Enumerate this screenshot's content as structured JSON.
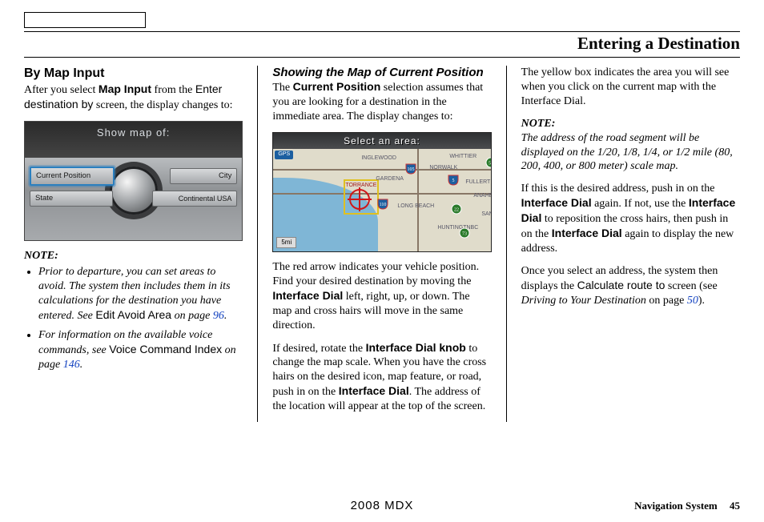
{
  "header": {
    "title": "Entering a Destination"
  },
  "footer": {
    "model": "2008 MDX",
    "system_label": "Navigation System",
    "page_number": "45"
  },
  "col1": {
    "heading": "By Map Input",
    "intro_1": "After you select ",
    "intro_bold": "Map Input",
    "intro_2": " from the ",
    "intro_sans": "Enter destination by",
    "intro_3": " screen, the display changes to:",
    "fig": {
      "title": "Show map of:",
      "btn_cp": "Current Position",
      "btn_city": "City",
      "btn_state": "State",
      "btn_cont": "Continental USA"
    },
    "note_label": "NOTE:",
    "bullet1_a": "Prior to departure, you can set areas to avoid. The system then includes them in its calculations for the destination you have entered. See ",
    "bullet1_sans": "Edit Avoid Area",
    "bullet1_b": " on page ",
    "bullet1_link": "96",
    "bullet1_c": ".",
    "bullet2_a": "For information on the available voice commands, see ",
    "bullet2_sans": "Voice Command Index",
    "bullet2_b": " on page ",
    "bullet2_link": "146",
    "bullet2_c": "."
  },
  "col2": {
    "subhead": "Showing the Map of Current Position",
    "p1_a": "The ",
    "p1_bold": "Current Position",
    "p1_b": " selection assumes that you are looking for a destination in the immediate area. The display changes to:",
    "fig": {
      "topbar": "Select an area:",
      "gps": "GPS",
      "scale": "5mi",
      "labels": {
        "inglewood": "INGLEWOOD",
        "norwalk": "NORWALK",
        "whittier": "WHITTIER",
        "torrance": "TORRANCE",
        "longbeach": "LONG BEACH",
        "fullerton": "FULLERT",
        "gardena": "GARDENA",
        "anaheim": "ANAHEI",
        "huntington": "HUNTINGTNBC",
        "santa": "SANT"
      },
      "routes": {
        "r105": "105",
        "r110": "110",
        "r5": "5",
        "r22": "22",
        "r73": "73",
        "r57": "57"
      }
    },
    "p2_a": "The red arrow indicates your vehicle position. Find your desired destination by moving the ",
    "p2_bold": "Interface Dial",
    "p2_b": " left, right, up, or down. The map and cross hairs will move in the same direction.",
    "p3_a": "If desired, rotate the ",
    "p3_bold1": "Interface Dial knob",
    "p3_b": " to change the map scale. When you have the cross hairs on the desired icon, map feature, or road, push in on the ",
    "p3_bold2": "Interface Dial",
    "p3_c": ". The address of the location will appear at the top of the screen."
  },
  "col3": {
    "p1": "The yellow box indicates the area you will see when you click on the current map with the Interface Dial.",
    "note_label": "NOTE:",
    "note_text": "The address of the road segment will be displayed on the 1/20, 1/8, 1/4, or 1/2 mile (80, 200, 400, or 800 meter) scale map.",
    "p2_a": "If this is the desired address, push in on the ",
    "p2_bold1": "Interface Dial",
    "p2_b": " again. If not, use the ",
    "p2_bold2": "Interface Dial",
    "p2_c": " to reposition the cross hairs, then push in on the ",
    "p2_bold3": "Interface Dial",
    "p2_d": " again to display the new address.",
    "p3_a": "Once you select an address, the system then displays the ",
    "p3_sans": "Calculate route to",
    "p3_b": " screen (see ",
    "p3_ital": "Driving to Your Destination",
    "p3_c": " on page ",
    "p3_link": "50",
    "p3_d": ")."
  }
}
